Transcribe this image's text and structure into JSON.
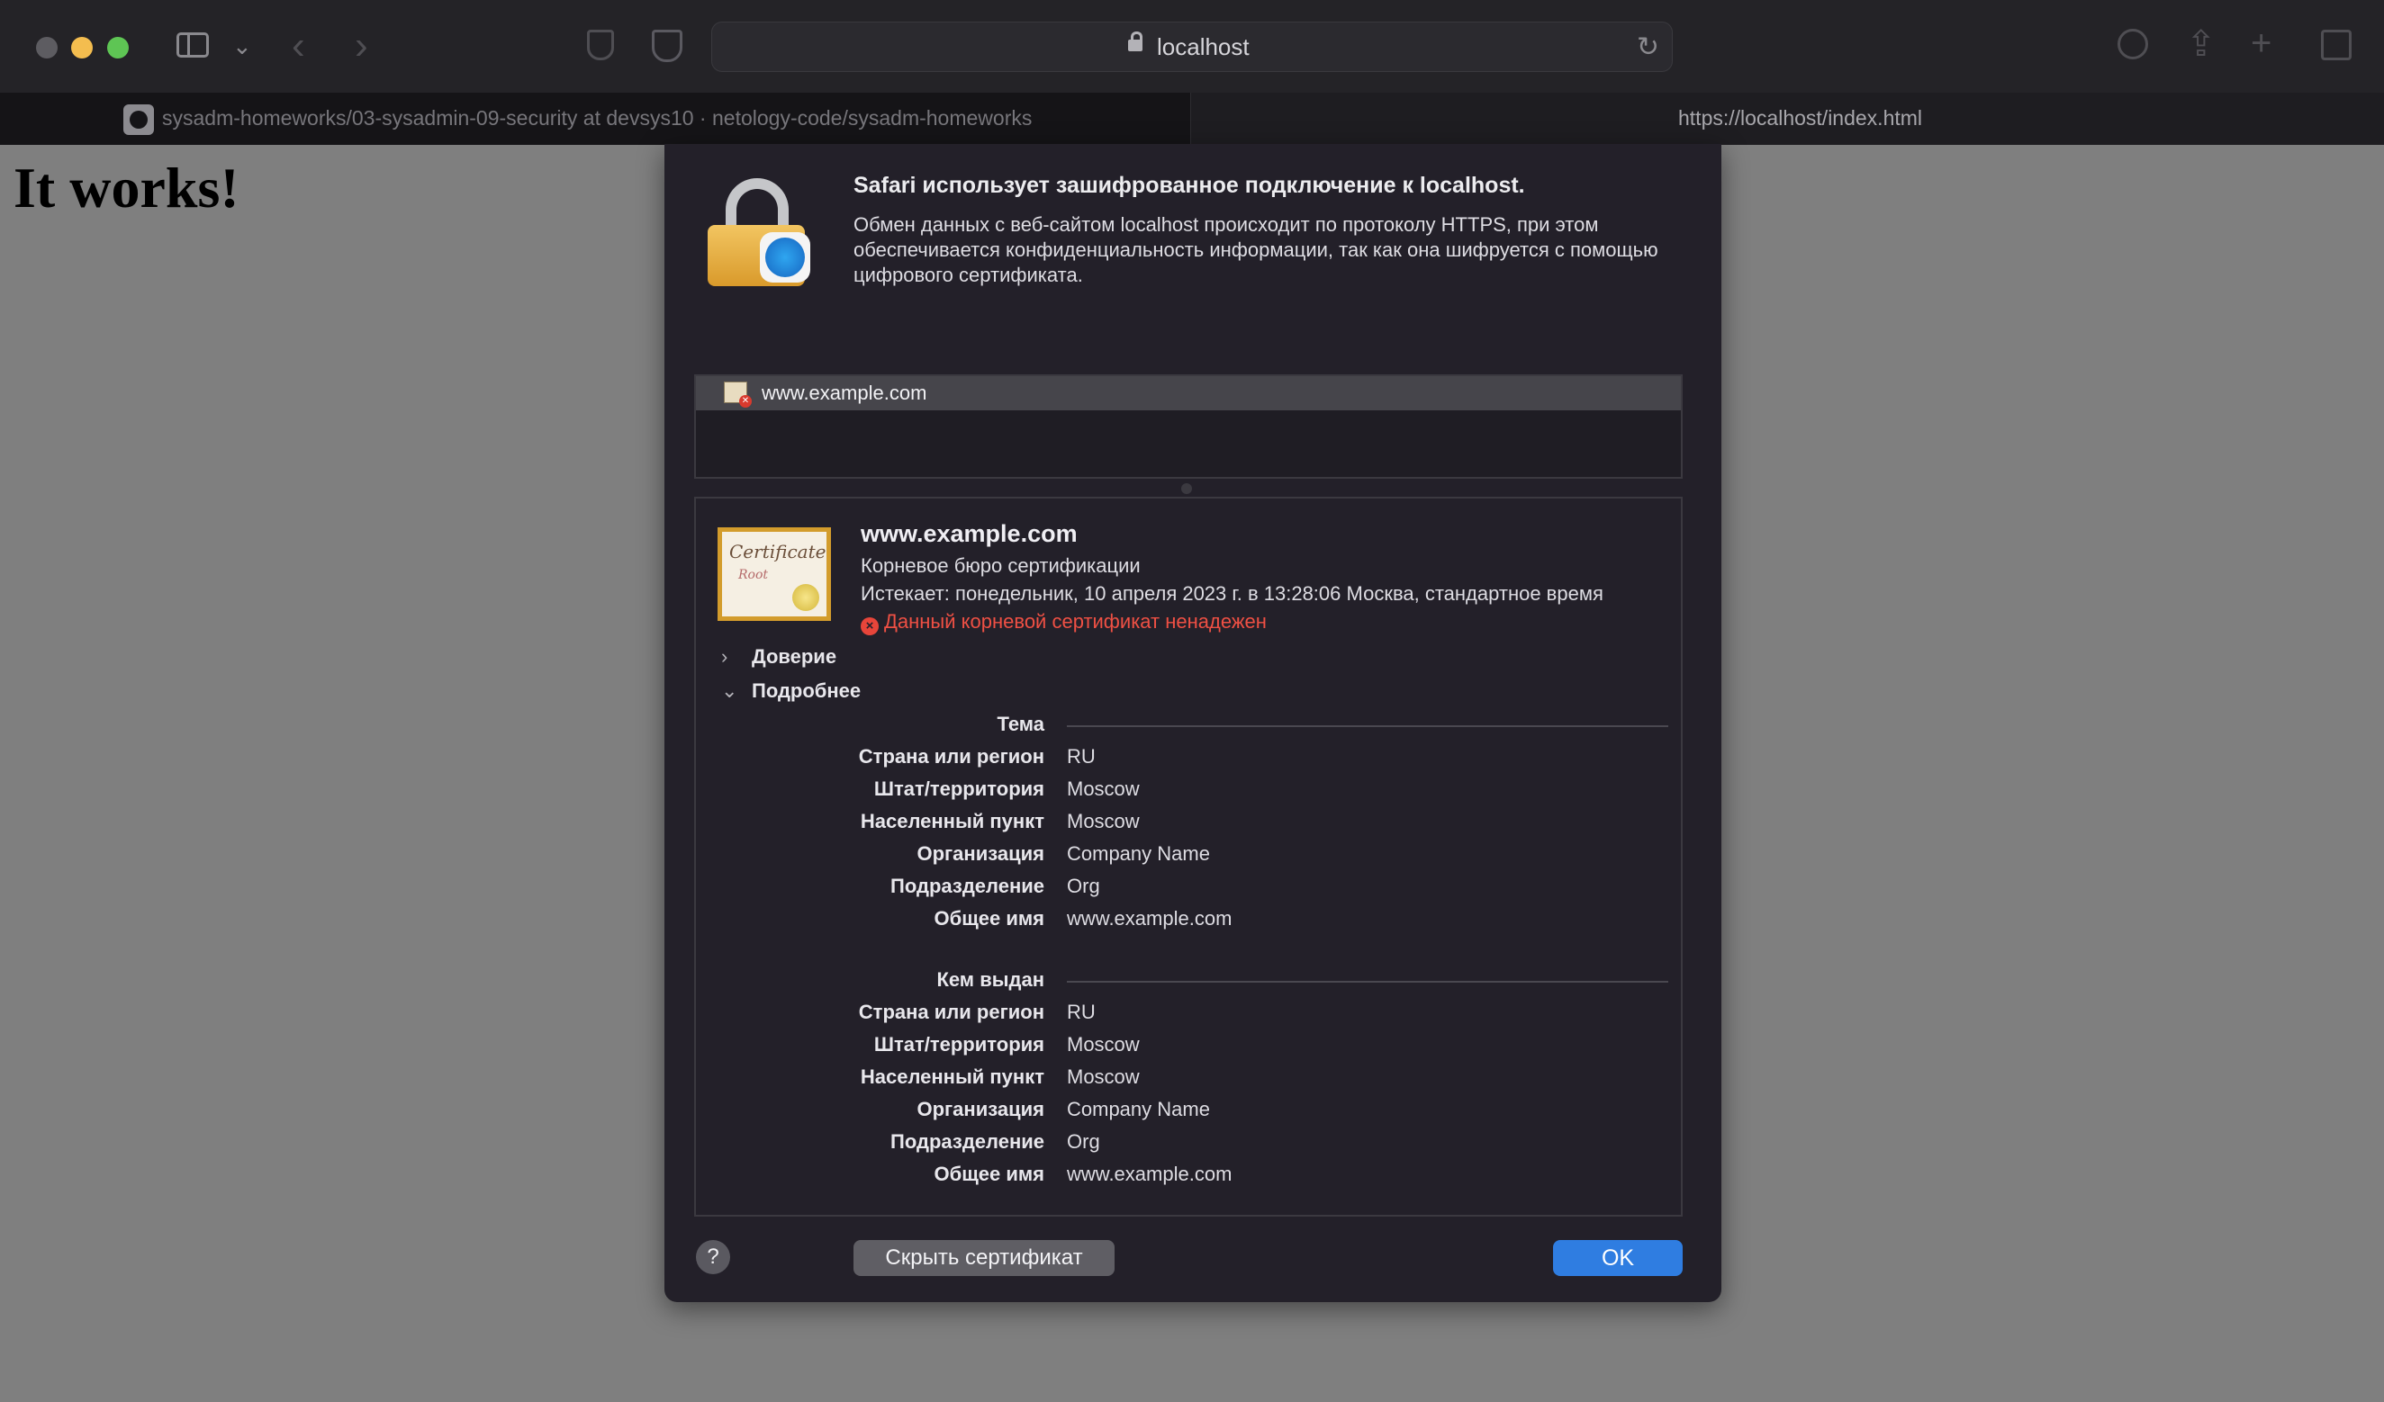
{
  "browser": {
    "address": "localhost",
    "tabs": [
      {
        "title": "sysadm-homeworks/03-sysadmin-09-security at devsys10 · netology-code/sysadm-homeworks"
      },
      {
        "title": "https://localhost/index.html"
      }
    ]
  },
  "page": {
    "heading": "It works!"
  },
  "sheet": {
    "header_title": "Safari использует зашифрованное подключение к localhost.",
    "header_description": "Обмен данных с веб-сайтом localhost происходит по протоколу HTTPS, при этом обеспечивается конфиденциальность информации, так как она шифруется с помощью цифрового сертификата.",
    "chain_item": "www.example.com",
    "certificate": {
      "name": "www.example.com",
      "type": "Корневое бюро сертификации",
      "expires": "Истекает: понедельник, 10 апреля 2023 г. в 13:28:06 Москва, стандартное время",
      "warning": "Данный корневой сертификат ненадежен",
      "icon_text_1": "Certificate",
      "icon_text_2": "Root"
    },
    "trust_label": "Доверие",
    "details_label": "Подробнее",
    "subject": {
      "title": "Тема",
      "rows": [
        {
          "key": "Страна или регион",
          "value": "RU"
        },
        {
          "key": "Штат/территория",
          "value": "Moscow"
        },
        {
          "key": "Населенный пункт",
          "value": "Moscow"
        },
        {
          "key": "Организация",
          "value": "Company Name"
        },
        {
          "key": "Подразделение",
          "value": "Org"
        },
        {
          "key": "Общее имя",
          "value": "www.example.com"
        }
      ]
    },
    "issuer": {
      "title": "Кем выдан",
      "rows": [
        {
          "key": "Страна или регион",
          "value": "RU"
        },
        {
          "key": "Штат/территория",
          "value": "Moscow"
        },
        {
          "key": "Населенный пункт",
          "value": "Moscow"
        },
        {
          "key": "Организация",
          "value": "Company Name"
        },
        {
          "key": "Подразделение",
          "value": "Org"
        },
        {
          "key": "Общее имя",
          "value": "www.example.com"
        }
      ]
    },
    "buttons": {
      "help": "?",
      "hide_certificate": "Скрыть сертификат",
      "ok": "OK"
    }
  }
}
